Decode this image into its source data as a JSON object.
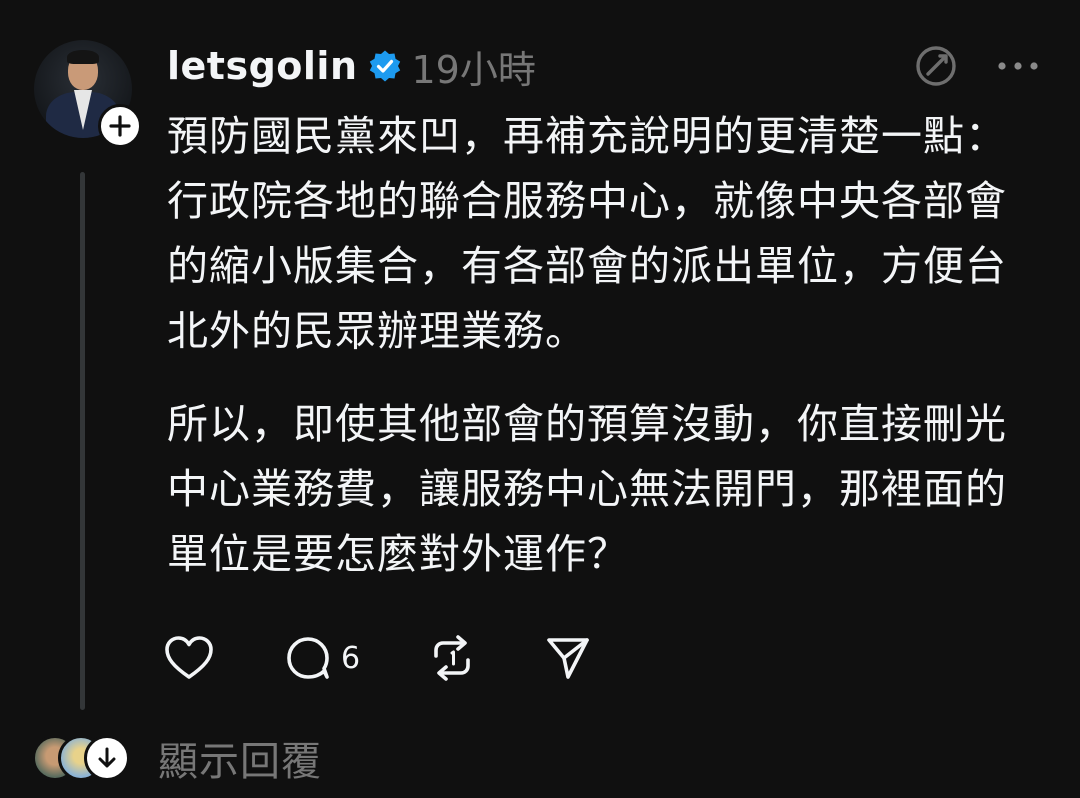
{
  "post": {
    "username": "letsgolin",
    "timestamp": "19小時",
    "paragraphs": [
      "預防國民黨來凹，再補充說明的更清楚一點：行政院各地的聯合服務中心，就像中央各部會的縮小版集合，有各部會的派出單位，方便台北外的民眾辦理業務。",
      "所以，即使其他部會的預算沒動，你直接刪光中心業務費，讓服務中心無法開門，那裡面的單位是要怎麼對外運作？"
    ],
    "reply_count": "6",
    "show_replies_label": "顯示回覆"
  },
  "icons": {
    "verified": "verified-badge-icon",
    "translate": "translate-icon",
    "more": "more-options-icon",
    "like": "heart-icon",
    "comment": "comment-icon",
    "repost": "repost-icon",
    "share": "send-icon",
    "follow": "plus-icon",
    "expand": "arrow-down-icon"
  },
  "colors": {
    "background": "#101010",
    "text": "#f3f5f7",
    "muted": "#777777",
    "verified": "#1d9bf0",
    "thread_line": "#333638"
  }
}
